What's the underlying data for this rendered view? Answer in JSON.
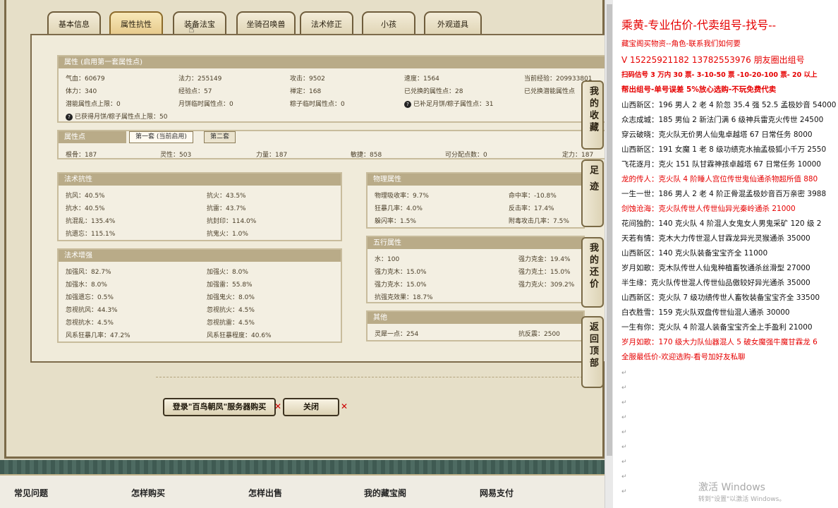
{
  "tabs": [
    "基本信息",
    "属性抗性",
    "装备法宝",
    "坐骑召唤兽",
    "法术修正",
    "小孩",
    "外观道具"
  ],
  "attributes": {
    "header": "属性 (启用第一套属性点)",
    "rows": [
      [
        "气血：60679",
        "法力：255149",
        "攻击：9502",
        "速度：1564",
        "当前经验：209933801"
      ],
      [
        "体力：340",
        "经验点：57",
        "禅定：168",
        "已兑换的属性点：28",
        "已兑换潜能属性点"
      ],
      [
        "潜能属性点上限：0",
        "月饼临时属性点：0",
        "粽子临时属性点：0",
        "已补足月饼/粽子属性点：31",
        ""
      ]
    ],
    "extra": "已获得月饼/粽子属性点上限：50"
  },
  "points": {
    "header": "属性点",
    "subtabs": [
      "第一套 (当前启用)",
      "第二套"
    ],
    "values": [
      "根骨：187",
      "灵性：503",
      "力量：187",
      "敏捷：858",
      "可分配点数：0",
      "定力：187"
    ]
  },
  "resist": {
    "header": "法术抗性",
    "rows": [
      [
        "抗风：40.5%",
        "抗火：43.5%"
      ],
      [
        "抗水：40.5%",
        "抗雷：43.7%"
      ],
      [
        "抗混乱：135.4%",
        "抗封印：114.0%"
      ],
      [
        "抗遗忘：115.1%",
        "抗鬼火：1.0%"
      ]
    ]
  },
  "enhance": {
    "header": "法术增强",
    "rows": [
      [
        "加强风：82.7%",
        "加强火：8.0%"
      ],
      [
        "加强水：8.0%",
        "加强雷：55.8%"
      ],
      [
        "加强遗忘：0.5%",
        "加强鬼火：8.0%"
      ],
      [
        "忽视抗风：44.3%",
        "忽视抗火：4.5%"
      ],
      [
        "忽视抗水：4.5%",
        "忽视抗雷：4.5%"
      ],
      [
        "风系狂暴几率：47.2%",
        "风系狂暴程度：40.6%"
      ]
    ]
  },
  "physical": {
    "header": "物理属性",
    "rows": [
      [
        "物理吸收率：9.7%",
        "命中率：-10.8%"
      ],
      [
        "狂暴几率：4.0%",
        "反击率：17.4%"
      ],
      [
        "躲闪率：1.5%",
        "附毒攻击几率：7.5%"
      ]
    ]
  },
  "elements": {
    "header": "五行属性",
    "rows": [
      [
        "水：100",
        "强力克金：19.4%"
      ],
      [
        "强力克木：15.0%",
        "强力克土：15.0%"
      ],
      [
        "强力克水：15.0%",
        "强力克火：309.2%"
      ],
      [
        "抗强克效果：18.7%",
        ""
      ]
    ]
  },
  "other": {
    "header": "其他",
    "rows": [
      [
        "灵犀一点：254",
        "抗反震：2500"
      ]
    ]
  },
  "sidebar": [
    "我的收藏",
    "足迹",
    "我的还价",
    "返回顶部"
  ],
  "actions": {
    "buy": "登录\"百鸟朝凤\"服务器购买",
    "close": "关闭"
  },
  "footer": [
    "常见问题",
    "怎样购买",
    "怎样出售",
    "我的藏宝阁",
    "网易支付"
  ],
  "doc": {
    "title": "乘黄-专业估价-代卖组号-找号--",
    "lines": [
      "藏宝阁买物资--角色-联系我们如何要",
      "V 15225921182    13782553976 朋友圈出组号",
      "扫码估号 3 万内 30 票- 3-10-50 票  -10-20-100 票- 20 以上",
      "帮出组号-单号误差 5%放心选购-不玩免费代卖",
      "山西新区：196 男人 2 老 4 阶忽 35.4 强 52.5 孟极妙音 54000",
      "众志成城：185 男仙 2 新法门满 6 级神兵雷克火传世 24500",
      "穿云破晓：克火队无价男人仙鬼卓越塔 67 日常任务 8000",
      "山西新区：191 女魔 1 老 8 级功绩克水抽孟极狐小千万 2550",
      "飞花逐月：克火 151 队甘霖神孩卓越塔 67 日常任务 10000",
      "龙的传人：克火队 4 阶睡人宫位传世鬼仙通杀物超所值 880",
      "一生一世：186 男人 2 老 4 阶正骨混孟极妙音百万亲密 3988",
      "剑蚀沧海：克火队传世人传世仙异光秦岭通杀 21000",
      "花间独酌：140 克火队 4 阶混人女鬼女人男鬼采矿 120 级 2",
      "天若有情：克木大力传世混人甘霖龙异光灵猴通杀 35000",
      "山西新区：140 克火队装备宝宝齐全 11000",
      "岁月如歌：克木队传世人仙鬼种植畜牧通杀丝滑型 27000",
      "半生缘：克火队传世混人传世仙品傲较好异光通杀 35000",
      "山西新区：克火队 7 级功绩传世人畜牧装备宝宝齐全 33500",
      "白衣胜雪：159 克火队双盘传世仙混人通杀 30000",
      "一生有你：克火队 4 阶混人装备宝宝齐全上手盈利 21000",
      "岁月如歌：170 级大力队仙器混人 5 破女魔强牛魔甘霖龙 6",
      "全服最低价-欢迎选购-看号加好友私聊"
    ],
    "watermark_title": "激活 Windows",
    "watermark_sub": "转到\"设置\"以激活 Windows。"
  }
}
